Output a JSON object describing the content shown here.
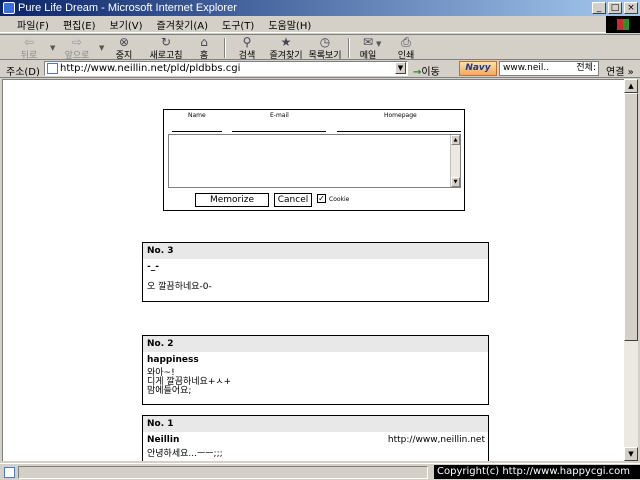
{
  "window": {
    "title": "Pure Life Dream - Microsoft Internet Explorer",
    "min": "_",
    "max": "□",
    "close": "×"
  },
  "menu": [
    "파일(F)",
    "편집(E)",
    "보기(V)",
    "즐겨찾기(A)",
    "도구(T)",
    "도움말(H)"
  ],
  "toolbar": {
    "back": "뒤로",
    "forward": "앞으로",
    "stop": "중지",
    "refresh": "새로고침",
    "home": "홈",
    "search": "검색",
    "favorites": "즐겨찾기",
    "history": "목록보기",
    "mail": "메일",
    "print": "인쇄"
  },
  "address": {
    "label": "주소(D)",
    "url": "http://www.neillin.net/pld/pldbbs.cgi",
    "go": "이동",
    "navy_logo": "Navy",
    "navy_search": "www.neil..",
    "navy_all": "전체:",
    "links": "연결 »"
  },
  "form": {
    "name_label": "Name",
    "email_label": "E-mail",
    "homepage_label": "Homepage",
    "memorize_button": "Memorize",
    "cancel_button": "Cancel",
    "cookie_label": "Cookie",
    "cookie_checked": true
  },
  "posts": [
    {
      "no": "No. 3",
      "author": "-_-",
      "homepage": "",
      "lines": [
        "",
        "오 깔끔하네요-0-"
      ]
    },
    {
      "no": "No. 2",
      "author": "happiness",
      "homepage": "",
      "lines": [
        "와아~!",
        "디게 깔끔하네요+ㅅ+",
        "맘에들어요;"
      ]
    },
    {
      "no": "No. 1",
      "author": "Neillin",
      "homepage": "http://www,neillin.net",
      "lines": [
        "안녕하세요...ㅡㅡ;;;"
      ]
    }
  ],
  "status": {
    "copyright": "Copyright(c) http://www.happycgi.com"
  }
}
